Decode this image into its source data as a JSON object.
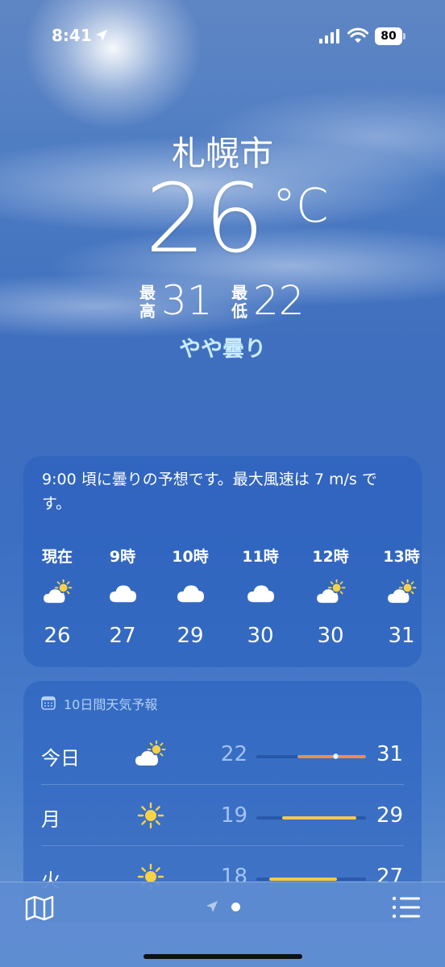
{
  "status_bar": {
    "time": "8:41",
    "battery": "80"
  },
  "location": {
    "city": "札幌市"
  },
  "current": {
    "temp": "26",
    "unit": "°C",
    "high_label": "最高",
    "high": "31",
    "low_label": "最低",
    "low": "22",
    "condition": "やや曇り"
  },
  "hourly": {
    "summary": "9:00 頃に曇りの予想です。最大風速は 7 m/s です。",
    "items": [
      {
        "label": "現在",
        "icon": "partly-cloudy-icon",
        "temp": "26"
      },
      {
        "label": "9時",
        "icon": "cloud-icon",
        "temp": "27"
      },
      {
        "label": "10時",
        "icon": "cloud-icon",
        "temp": "29"
      },
      {
        "label": "11時",
        "icon": "cloud-icon",
        "temp": "30"
      },
      {
        "label": "12時",
        "icon": "partly-cloudy-icon",
        "temp": "30"
      },
      {
        "label": "13時",
        "icon": "partly-cloudy-icon",
        "temp": "31"
      }
    ]
  },
  "daily": {
    "title": "10日間天気予報",
    "days": [
      {
        "day": "今日",
        "icon": "partly-cloudy-icon",
        "low": "22",
        "high": "31"
      },
      {
        "day": "月",
        "icon": "sun-icon",
        "low": "19",
        "high": "29"
      },
      {
        "day": "火",
        "icon": "sun-icon",
        "low": "18",
        "high": "27"
      }
    ]
  },
  "colors": {
    "condition_text": "#c8ecff",
    "bar_warm": "#e8904a",
    "bar_yellow": "#f2c94c",
    "sun": "#f7d148"
  }
}
